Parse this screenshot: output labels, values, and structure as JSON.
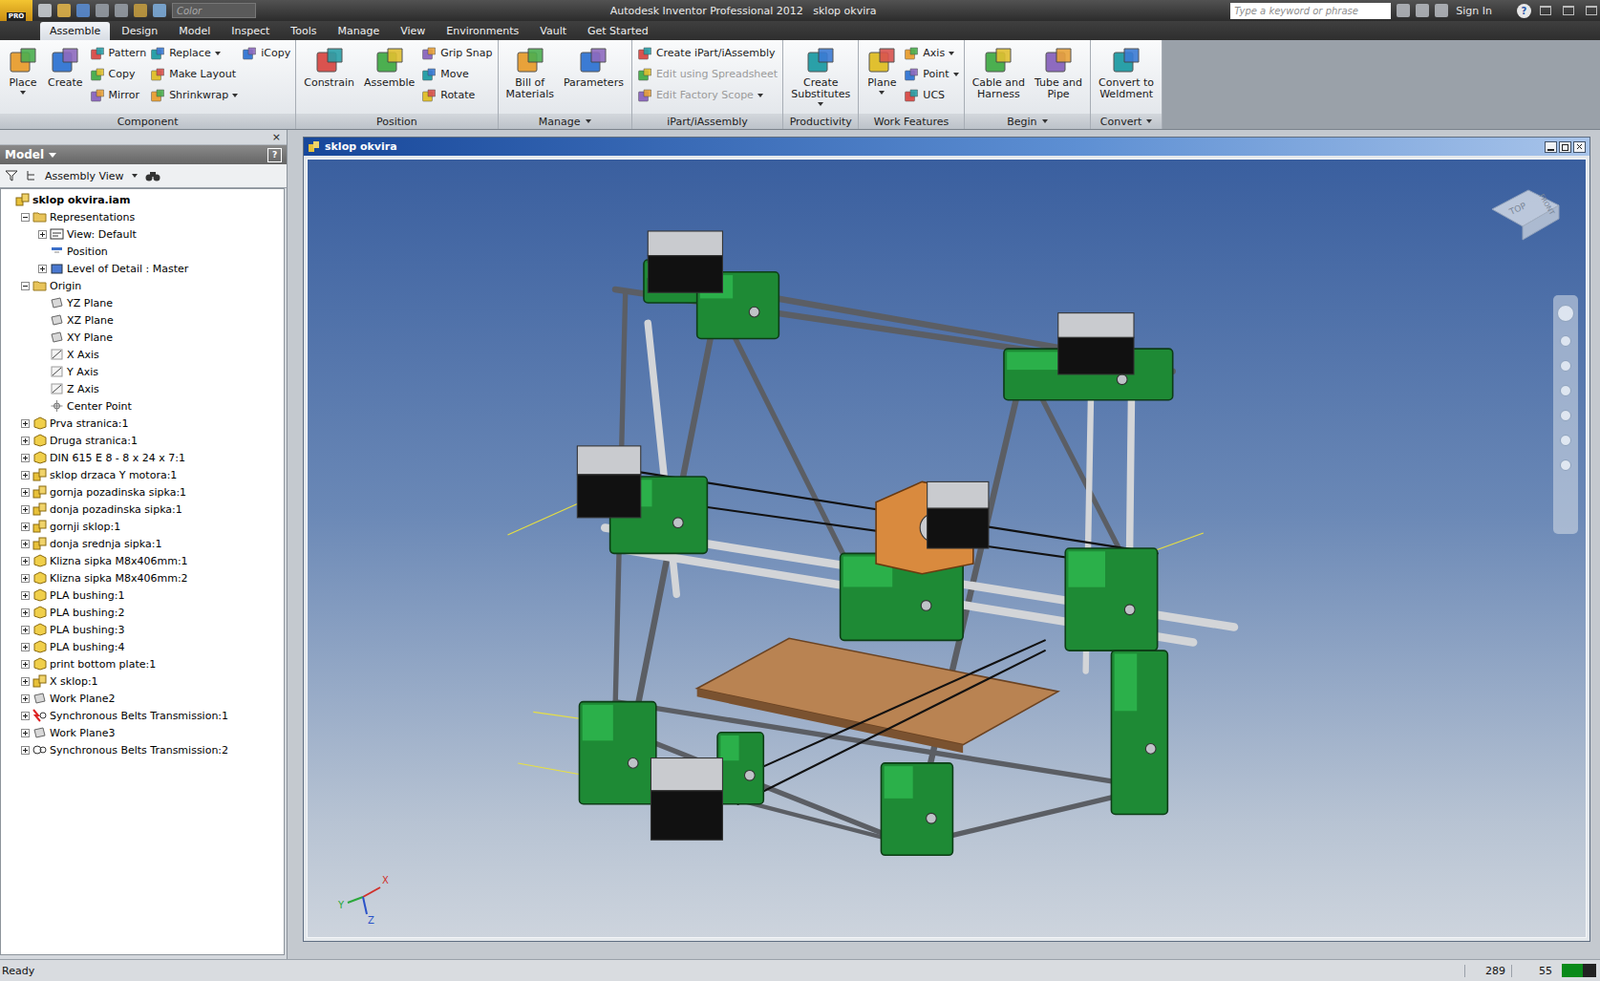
{
  "title_bar": {
    "app_badge": "PRO",
    "color_field": "Color",
    "app": "Autodesk Inventor Professional 2012",
    "file": "sklop okvira",
    "search_placeholder": "Type a keyword or phrase",
    "sign_in": "Sign In",
    "help": "?"
  },
  "tabs": [
    {
      "label": "Assemble",
      "selected": true
    },
    {
      "label": "Design",
      "selected": false
    },
    {
      "label": "Model",
      "selected": false
    },
    {
      "label": "Inspect",
      "selected": false
    },
    {
      "label": "Tools",
      "selected": false
    },
    {
      "label": "Manage",
      "selected": false
    },
    {
      "label": "View",
      "selected": false
    },
    {
      "label": "Environments",
      "selected": false
    },
    {
      "label": "Vault",
      "selected": false
    },
    {
      "label": "Get Started",
      "selected": false
    }
  ],
  "ribbon": {
    "panels": [
      {
        "label": "Component",
        "dropdown": false,
        "large": [
          {
            "label": "Place",
            "dropdown": true,
            "disabled": false
          },
          {
            "label": "Create",
            "dropdown": false,
            "disabled": false
          }
        ],
        "columns": [
          [
            {
              "label": "Pattern",
              "dropdown": false,
              "disabled": false
            },
            {
              "label": "Copy",
              "dropdown": false,
              "disabled": false
            },
            {
              "label": "Mirror",
              "dropdown": false,
              "disabled": false
            }
          ],
          [
            {
              "label": "Replace",
              "dropdown": true,
              "disabled": false
            },
            {
              "label": "Make Layout",
              "dropdown": false,
              "disabled": false
            },
            {
              "label": "Shrinkwrap",
              "dropdown": true,
              "disabled": false
            }
          ],
          [
            {
              "label": "iCopy",
              "dropdown": false,
              "disabled": false
            }
          ]
        ]
      },
      {
        "label": "Position",
        "dropdown": false,
        "large": [
          {
            "label": "Constrain",
            "dropdown": false,
            "disabled": false
          },
          {
            "label": "Assemble",
            "dropdown": false,
            "disabled": false
          }
        ],
        "columns": [
          [
            {
              "label": "Grip Snap",
              "dropdown": false,
              "disabled": false
            },
            {
              "label": "Move",
              "dropdown": false,
              "disabled": false
            },
            {
              "label": "Rotate",
              "dropdown": false,
              "disabled": false
            }
          ]
        ]
      },
      {
        "label": "Manage",
        "dropdown": true,
        "large": [
          {
            "label": "Bill of\nMaterials",
            "dropdown": false,
            "disabled": false
          },
          {
            "label": "Parameters",
            "dropdown": false,
            "disabled": false
          }
        ],
        "columns": []
      },
      {
        "label": "iPart/iAssembly",
        "dropdown": false,
        "large": [],
        "columns": [
          [
            {
              "label": "Create iPart/iAssembly",
              "dropdown": false,
              "disabled": false
            },
            {
              "label": "Edit using Spreadsheet",
              "dropdown": false,
              "disabled": true
            },
            {
              "label": "Edit Factory Scope",
              "dropdown": true,
              "disabled": true
            }
          ]
        ]
      },
      {
        "label": "Productivity",
        "dropdown": false,
        "large": [
          {
            "label": "Create\nSubstitutes",
            "dropdown": true,
            "disabled": false
          }
        ],
        "columns": []
      },
      {
        "label": "Work Features",
        "dropdown": false,
        "large": [
          {
            "label": "Plane",
            "dropdown": true,
            "disabled": false
          }
        ],
        "columns": [
          [
            {
              "label": "Axis",
              "dropdown": true,
              "disabled": false
            },
            {
              "label": "Point",
              "dropdown": true,
              "disabled": false
            },
            {
              "label": "UCS",
              "dropdown": false,
              "disabled": false
            }
          ]
        ]
      },
      {
        "label": "Begin",
        "dropdown": true,
        "large": [
          {
            "label": "Cable and\nHarness",
            "dropdown": false,
            "disabled": false
          },
          {
            "label": "Tube and\nPipe",
            "dropdown": false,
            "disabled": false
          }
        ],
        "columns": []
      },
      {
        "label": "Convert",
        "dropdown": true,
        "large": [
          {
            "label": "Convert to\nWeldment",
            "dropdown": false,
            "disabled": false
          }
        ],
        "columns": []
      }
    ]
  },
  "browser": {
    "close": "×",
    "title": "Model",
    "dropdown": true,
    "help": "?",
    "view_selector": "Assembly View",
    "items": [
      {
        "label": "sklop okvira.iam",
        "level": 0,
        "kind": "assembly"
      },
      {
        "label": "Representations",
        "level": 1,
        "kind": "folder",
        "expanded": true
      },
      {
        "label": "View: Default",
        "level": 2,
        "kind": "view",
        "expanded": false
      },
      {
        "label": "Position",
        "level": 2,
        "kind": "position"
      },
      {
        "label": "Level of Detail : Master",
        "level": 2,
        "kind": "lod",
        "expanded": false
      },
      {
        "label": "Origin",
        "level": 1,
        "kind": "folder",
        "expanded": true
      },
      {
        "label": "YZ Plane",
        "level": 2,
        "kind": "plane"
      },
      {
        "label": "XZ Plane",
        "level": 2,
        "kind": "plane"
      },
      {
        "label": "XY Plane",
        "level": 2,
        "kind": "plane"
      },
      {
        "label": "X Axis",
        "level": 2,
        "kind": "axis"
      },
      {
        "label": "Y Axis",
        "level": 2,
        "kind": "axis"
      },
      {
        "label": "Z Axis",
        "level": 2,
        "kind": "axis"
      },
      {
        "label": "Center Point",
        "level": 2,
        "kind": "point"
      },
      {
        "label": "Prva stranica:1",
        "level": 1,
        "kind": "part",
        "expanded": false
      },
      {
        "label": "Druga stranica:1",
        "level": 1,
        "kind": "part",
        "expanded": false
      },
      {
        "label": "DIN 615 E 8 - 8 x 24 x 7:1",
        "level": 1,
        "kind": "part",
        "expanded": false
      },
      {
        "label": "sklop drzaca Y motora:1",
        "level": 1,
        "kind": "assembly",
        "expanded": false
      },
      {
        "label": "gornja pozadinska sipka:1",
        "level": 1,
        "kind": "assembly",
        "expanded": false
      },
      {
        "label": "donja pozadinska sipka:1",
        "level": 1,
        "kind": "assembly",
        "expanded": false
      },
      {
        "label": "gornji sklop:1",
        "level": 1,
        "kind": "assembly",
        "expanded": false
      },
      {
        "label": "donja srednja sipka:1",
        "level": 1,
        "kind": "assembly",
        "expanded": false
      },
      {
        "label": "Klizna sipka M8x406mm:1",
        "level": 1,
        "kind": "part",
        "expanded": false
      },
      {
        "label": "Klizna sipka M8x406mm:2",
        "level": 1,
        "kind": "part",
        "expanded": false
      },
      {
        "label": "PLA bushing:1",
        "level": 1,
        "kind": "part",
        "expanded": false
      },
      {
        "label": "PLA bushing:2",
        "level": 1,
        "kind": "part",
        "expanded": false
      },
      {
        "label": "PLA bushing:3",
        "level": 1,
        "kind": "part",
        "expanded": false
      },
      {
        "label": "PLA bushing:4",
        "level": 1,
        "kind": "part",
        "expanded": false
      },
      {
        "label": "print bottom plate:1",
        "level": 1,
        "kind": "part",
        "expanded": false
      },
      {
        "label": "X sklop:1",
        "level": 1,
        "kind": "assembly",
        "expanded": false
      },
      {
        "label": "Work Plane2",
        "level": 1,
        "kind": "plane",
        "expanded": false
      },
      {
        "label": "Synchronous Belts Transmission:1",
        "level": 1,
        "kind": "belt",
        "expanded": false
      },
      {
        "label": "Work Plane3",
        "level": 1,
        "kind": "plane",
        "expanded": false
      },
      {
        "label": "Synchronous Belts Transmission:2",
        "level": 1,
        "kind": "belt-info",
        "expanded": false
      }
    ]
  },
  "document": {
    "title": "sklop okvira",
    "viewcube": {
      "top": "TOP",
      "front": "FRONT"
    },
    "axes": [
      {
        "label": "X",
        "color": "#d0302a"
      },
      {
        "label": "Y",
        "color": "#2aa83a"
      },
      {
        "label": "Z",
        "color": "#2a52c8"
      }
    ]
  },
  "status_bar": {
    "message": "Ready",
    "values": [
      "289",
      "55"
    ]
  }
}
